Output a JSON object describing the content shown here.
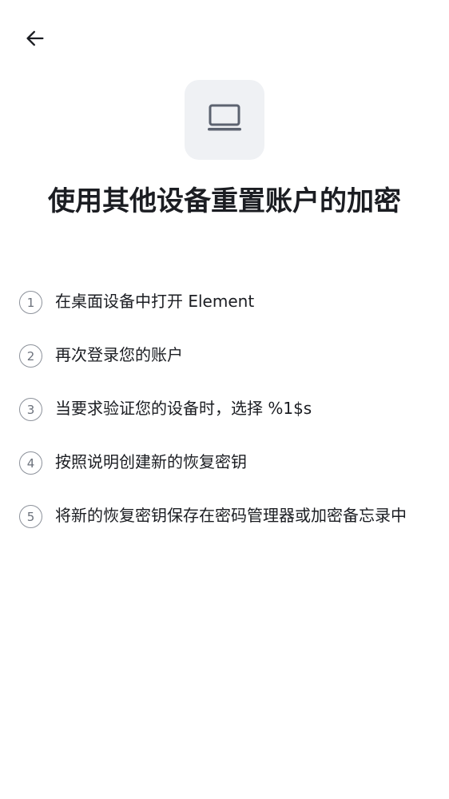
{
  "header": {
    "back_icon": "arrow-left-icon"
  },
  "hero": {
    "icon": "laptop-icon",
    "title": "使用其他设备重置账户的加密"
  },
  "steps": [
    {
      "number": "1",
      "text": "在桌面设备中打开 Element"
    },
    {
      "number": "2",
      "text": "再次登录您的账户"
    },
    {
      "number": "3",
      "text": "当要求验证您的设备时，选择 %1$s"
    },
    {
      "number": "4",
      "text": "按照说明创建新的恢复密钥"
    },
    {
      "number": "5",
      "text": "将新的恢复密钥保存在密码管理器或加密备忘录中"
    }
  ],
  "colors": {
    "text_primary": "#1b1d22",
    "text_secondary": "#6b717b",
    "icon_tile_bg": "#eff1f4",
    "icon_stroke": "#5c6370"
  }
}
